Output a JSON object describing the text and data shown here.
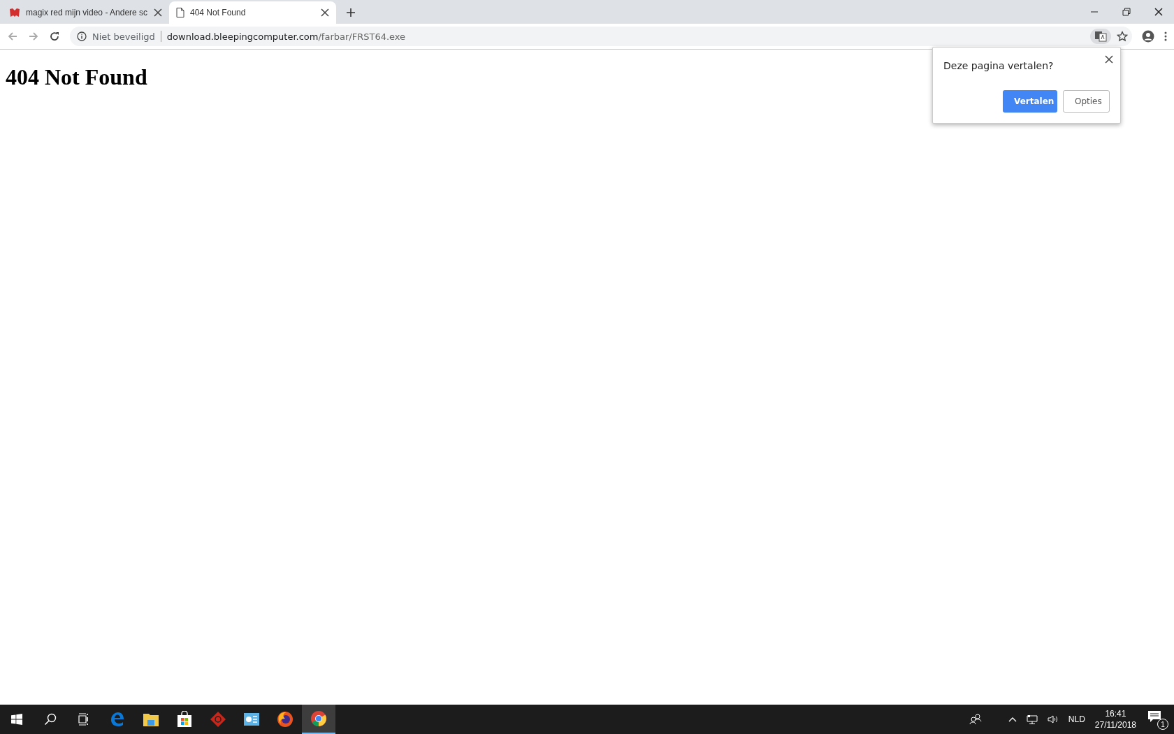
{
  "tabs": [
    {
      "title": "magix red mijn video - Andere sc",
      "kind": "site",
      "selected": false
    },
    {
      "title": "404 Not Found",
      "kind": "page",
      "selected": true
    }
  ],
  "address_bar": {
    "security": "Niet beveiligd",
    "host": "download.bleepingcomputer.com",
    "path": "/farbar/FRST64.exe"
  },
  "page": {
    "heading": "404 Not Found"
  },
  "translate_popup": {
    "question": "Deze pagina vertalen?",
    "buttons": [
      {
        "label": "Vertalen",
        "kind": "primary"
      },
      {
        "label": "Opties",
        "kind": "secondary"
      }
    ]
  },
  "taskbar": {
    "apps": [
      {
        "kind": "edge",
        "selected": false
      },
      {
        "kind": "explorer",
        "selected": false
      },
      {
        "kind": "store",
        "selected": false
      },
      {
        "kind": "game",
        "selected": false
      },
      {
        "kind": "control",
        "selected": false
      },
      {
        "kind": "firefox",
        "selected": false
      },
      {
        "kind": "chrome",
        "selected": true
      }
    ],
    "language": "NLD",
    "time": "16:41",
    "date": "27/11/2018",
    "notification_count": "1"
  }
}
